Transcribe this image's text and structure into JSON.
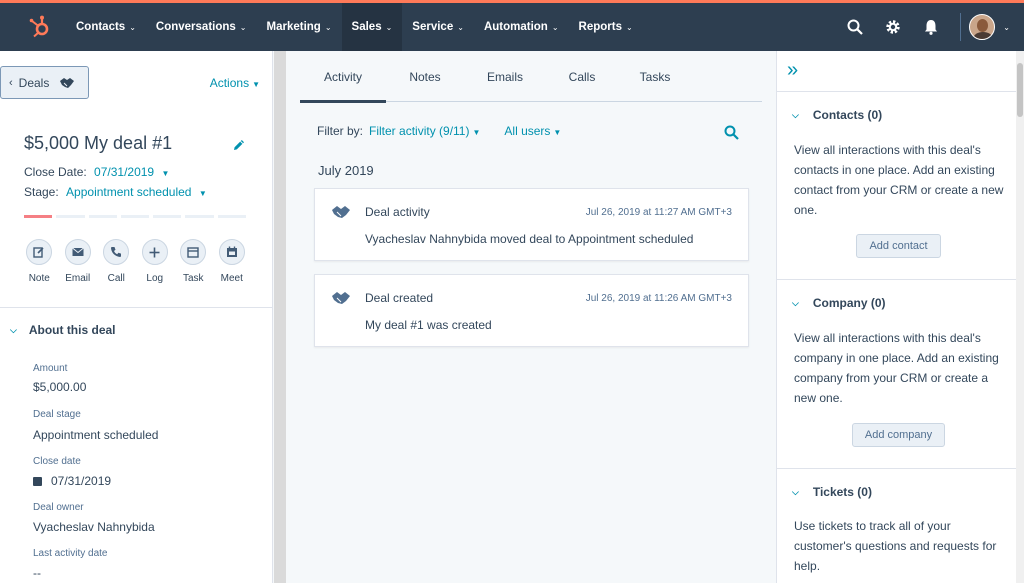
{
  "nav": {
    "items": [
      {
        "label": "Contacts",
        "active": false
      },
      {
        "label": "Conversations",
        "active": false
      },
      {
        "label": "Marketing",
        "active": false
      },
      {
        "label": "Sales",
        "active": true
      },
      {
        "label": "Service",
        "active": false
      },
      {
        "label": "Automation",
        "active": false
      },
      {
        "label": "Reports",
        "active": false
      }
    ],
    "accent": "#ff7a59",
    "background": "#2d3e50"
  },
  "left": {
    "back_label": "Deals",
    "actions_label": "Actions",
    "deal_name": "$5,000 My deal #1",
    "close_date_label": "Close Date:",
    "close_date_value": "07/31/2019",
    "stage_label": "Stage:",
    "stage_value": "Appointment scheduled",
    "progress": {
      "completed_segments": 1,
      "total_segments": 7
    },
    "activity_buttons": [
      {
        "label": "Note",
        "icon": "note-icon"
      },
      {
        "label": "Email",
        "icon": "email-icon"
      },
      {
        "label": "Call",
        "icon": "call-icon"
      },
      {
        "label": "Log",
        "icon": "plus-icon"
      },
      {
        "label": "Task",
        "icon": "task-icon"
      },
      {
        "label": "Meet",
        "icon": "calendar-icon"
      }
    ],
    "about_heading": "About this deal",
    "properties": [
      {
        "label": "Amount",
        "value": "$5,000.00"
      },
      {
        "label": "Deal stage",
        "value": "Appointment scheduled"
      },
      {
        "label": "Close date",
        "value": "07/31/2019"
      },
      {
        "label": "Deal owner",
        "value": "Vyacheslav Nahnybida"
      },
      {
        "label": "Last activity date",
        "value": "--"
      }
    ]
  },
  "middle": {
    "tabs": [
      "Activity",
      "Notes",
      "Emails",
      "Calls",
      "Tasks"
    ],
    "active_tab": "Activity",
    "filter_label": "Filter by:",
    "filter_activity": "Filter activity (9/11)",
    "filter_users": "All users",
    "month": "July 2019",
    "cards": [
      {
        "title": "Deal activity",
        "time": "Jul 26, 2019 at 11:27 AM GMT+3",
        "body": "Vyacheslav Nahnybida moved deal to Appointment scheduled"
      },
      {
        "title": "Deal created",
        "time": "Jul 26, 2019 at 11:26 AM GMT+3",
        "body": "My deal #1 was created"
      }
    ]
  },
  "right": {
    "sections": [
      {
        "heading": "Contacts (0)",
        "text": "View all interactions with this deal's contacts in one place. Add an existing contact from your CRM or create a new one.",
        "button": "Add contact"
      },
      {
        "heading": "Company (0)",
        "text": "View all interactions with this deal's company in one place. Add an existing company from your CRM or create a new one.",
        "button": "Add company"
      },
      {
        "heading": "Tickets (0)",
        "text": "Use tickets to track all of your customer's questions and requests for help."
      }
    ]
  }
}
